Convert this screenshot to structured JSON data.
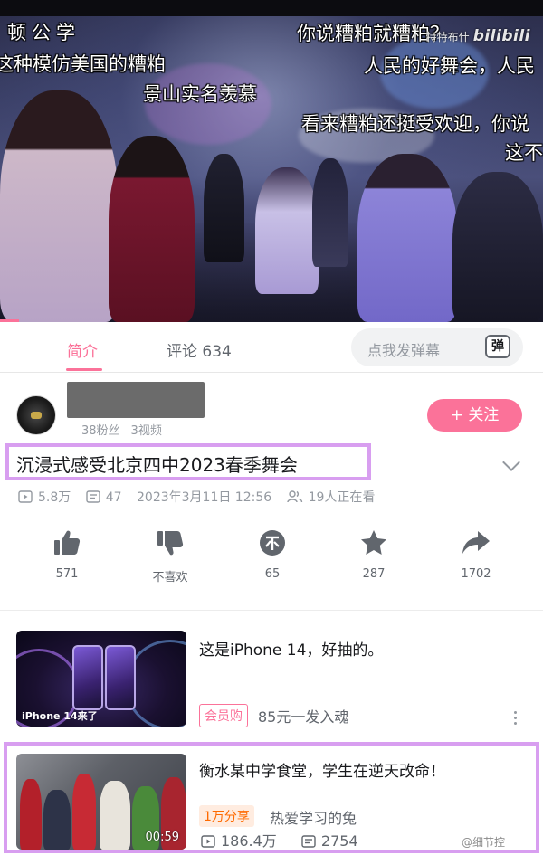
{
  "video": {
    "danmaku": [
      "顿公学",
      "这种模仿美国的糟粕",
      "景山实名羡慕",
      "你说糟粕就糟粕？",
      "人民的好舞会，人民",
      "看来糟粕还挺受欢迎，你说",
      "这不"
    ],
    "watermark_prefix": "特特布什",
    "watermark_logo": "bilibili",
    "progress_fraction": 0.035
  },
  "tabs": {
    "intro": "简介",
    "comments": "评论 634"
  },
  "danmu_input": {
    "placeholder": "点我发弹幕",
    "send_icon_label": "弹"
  },
  "uploader": {
    "fans": "38粉丝",
    "videos": "3视频",
    "follow_label": "+ 关注"
  },
  "video_info": {
    "title": "沉浸式感受北京四中2023春季舞会",
    "views": "5.8万",
    "danmaku_count": "47",
    "date": "2023年3月11日 12:56",
    "watching": "19人正在看"
  },
  "actions": {
    "like": "571",
    "dislike": "不喜欢",
    "coin": "65",
    "favorite": "287",
    "share": "1702"
  },
  "recommendations": [
    {
      "title": "这是iPhone 14，好抽的。",
      "badge": "会员购",
      "subtitle": "85元一发入魂",
      "thumb_caption": "iPhone 14来了"
    },
    {
      "title": "衡水某中学食堂，学生在逆天改命！",
      "badge": "1万分享",
      "author": "热爱学习的兔",
      "views": "186.4万",
      "danmaku": "2754",
      "duration": "00:59"
    }
  ],
  "watermark_weibo": "@细节控"
}
